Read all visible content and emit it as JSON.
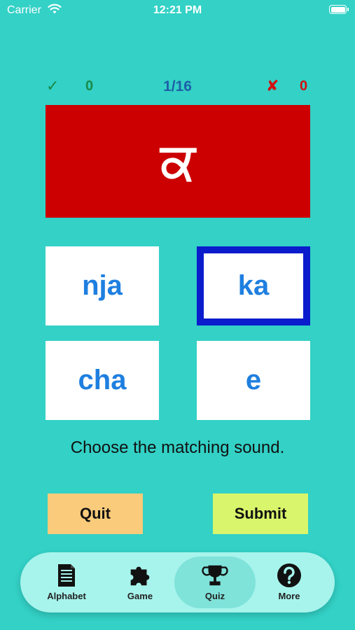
{
  "status_bar": {
    "carrier": "Carrier",
    "time": "12:21 PM"
  },
  "score": {
    "correct": "0",
    "progress": "1/16",
    "wrong": "0"
  },
  "question": {
    "letter": "ਕ"
  },
  "options": [
    "nja",
    "ka",
    "cha",
    "e"
  ],
  "selected_option": "ka",
  "instruction": "Choose the matching sound.",
  "buttons": {
    "quit": "Quit",
    "submit": "Submit"
  },
  "tabs": [
    {
      "label": "Alphabet",
      "icon": "document-icon"
    },
    {
      "label": "Game",
      "icon": "puzzle-icon"
    },
    {
      "label": "Quiz",
      "icon": "trophy-icon"
    },
    {
      "label": "More",
      "icon": "help-icon"
    }
  ],
  "active_tab": "Quiz",
  "colors": {
    "background": "#33d1c6",
    "letter_card": "#cc0000",
    "option_text": "#1f7fe0",
    "selected_border": "#0a1ccc",
    "quit_button": "#f9cb7b",
    "submit_button": "#d9f56b",
    "correct": "#1a8a4a",
    "wrong": "#d11010",
    "progress": "#1e5fa8"
  }
}
